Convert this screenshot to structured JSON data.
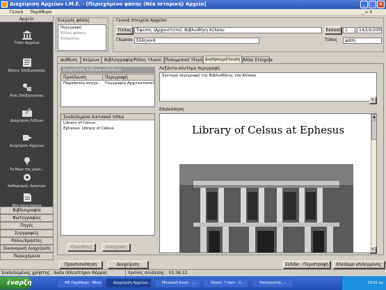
{
  "window": {
    "title": "Διαχείριση Αρχείων I.M.E. - [Περιεχόμενο φάσης (Νέα Ιστορική) Αρχείο]",
    "min": "_",
    "max": "□",
    "close": "×"
  },
  "menubar": {
    "items": [
      "Γενικά",
      "Παράθυρο"
    ],
    "mdi_controls": "_ ▫ ×"
  },
  "sidebar": {
    "header": "Αρχείο",
    "items": [
      {
        "label": "Τύποι Αρχείων",
        "icon": "museum-columns-icon"
      },
      {
        "label": "Βάσεις Επεξεργασίας",
        "icon": "book-icon"
      },
      {
        "label": "Ροές Επεξεργασίας",
        "icon": "flow-icon"
      },
      {
        "label": "Διαχείριση Λέξεων",
        "icon": "pen-book-icon"
      },
      {
        "label": "Διαχείριση Αρχείων",
        "icon": "arrows-icon"
      },
      {
        "label": "Το θέμα της μέρα...",
        "icon": "pin-icon"
      },
      {
        "label": "Καθορισμός Χρηστών",
        "icon": "marker-icon"
      },
      {
        "label": "Νέο περιεχόμενο επεξεργασίας",
        "icon": "document-icon"
      }
    ],
    "buttons": [
      "Βιβλιογραφία",
      "Φωτογραφίες",
      "Πηγές",
      "Συγγραφείς",
      "Ρόλοι/Χρήστες",
      "Οικονομική Διαχείριση",
      "Περιεχόμενα"
    ]
  },
  "phase_box": {
    "label": "Ενεργός φάσης",
    "items": [
      "Περιγραφή",
      "Άλλες φάσεις",
      "Ενέργειες"
    ]
  },
  "general": {
    "header": "Γενικά στοιχεία Αρχείου",
    "title_label": "Τίτλος",
    "title_value": "Έφεσος (Αρχαιότητα), Βιβλιοθήκη Κέλσου",
    "version_button": "Έκδοση",
    "version_value": "1",
    "date_value": "14/10/2005",
    "language_label": "Γλώσσα",
    "language_value": "Ελληνικά",
    "type_label": "Τύπος",
    "type_value": "φάση"
  },
  "tabs": [
    "Διάθεση",
    "Κείμενα",
    "Βιβλιογραφία/Ρόλος Υλικού",
    "Πολυμεσικό Υλικό",
    "Διαπραγμάτευση",
    "Άλλα Στοιχεία"
  ],
  "panel": {
    "keywords_header": "Διαχείριση λέξεων κλειδιών",
    "kw_cols": [
      "Προέλευση",
      "Περιγραφή"
    ],
    "kw_rows": [
      [
        "Παραδοτέο συγγρ...",
        "Γεωγραφία Αρχιτεκτονική"
      ]
    ],
    "short_desc_label": "Λεξάντα-σύντομη περιγραφή",
    "short_desc_value": "Σύντομη περιγραφή της Βιβλιοθήκης του Κέλσου",
    "related_header": "Συνδεδεμένα δικτυακά τόπια",
    "related_rows": [
      "Library of Celsus",
      "Ephesus: Library of Celsus"
    ],
    "desc_label": "Επισκόπηση",
    "viewer_title": "Library of Celsus at Ephesus",
    "btn_add": "Προσθήκη",
    "btn_delete": "Διαγραφή"
  },
  "bottom": {
    "btn_preview": "Προεπισκόπηση Αρχείου",
    "btn_manage": "Διαχείριση Αρχείου",
    "btn_next_phases": "Σελίδα - Περιστροφή",
    "btn_finish": "Κλείσιμο επιλεγμένης φάσης"
  },
  "statusbar": {
    "user_text": "Συνδεδεμένος χρήστης : bella (Κλειστήριο Θέρμα)",
    "time_text": "Χρόνος σύνδεσης : 01:36:12"
  },
  "taskbar": {
    "start": "έναρξη",
    "tasks": [
      "ΜΕ Παράθυρο - Micro...",
      "Διαχείριση Αρχείων...",
      "Microsoft Excel - ...",
      "Ολοκλ. 7 (Iom - 2...",
      "Υπολογιστής...:"
    ],
    "clock": "10:51 πμ"
  }
}
